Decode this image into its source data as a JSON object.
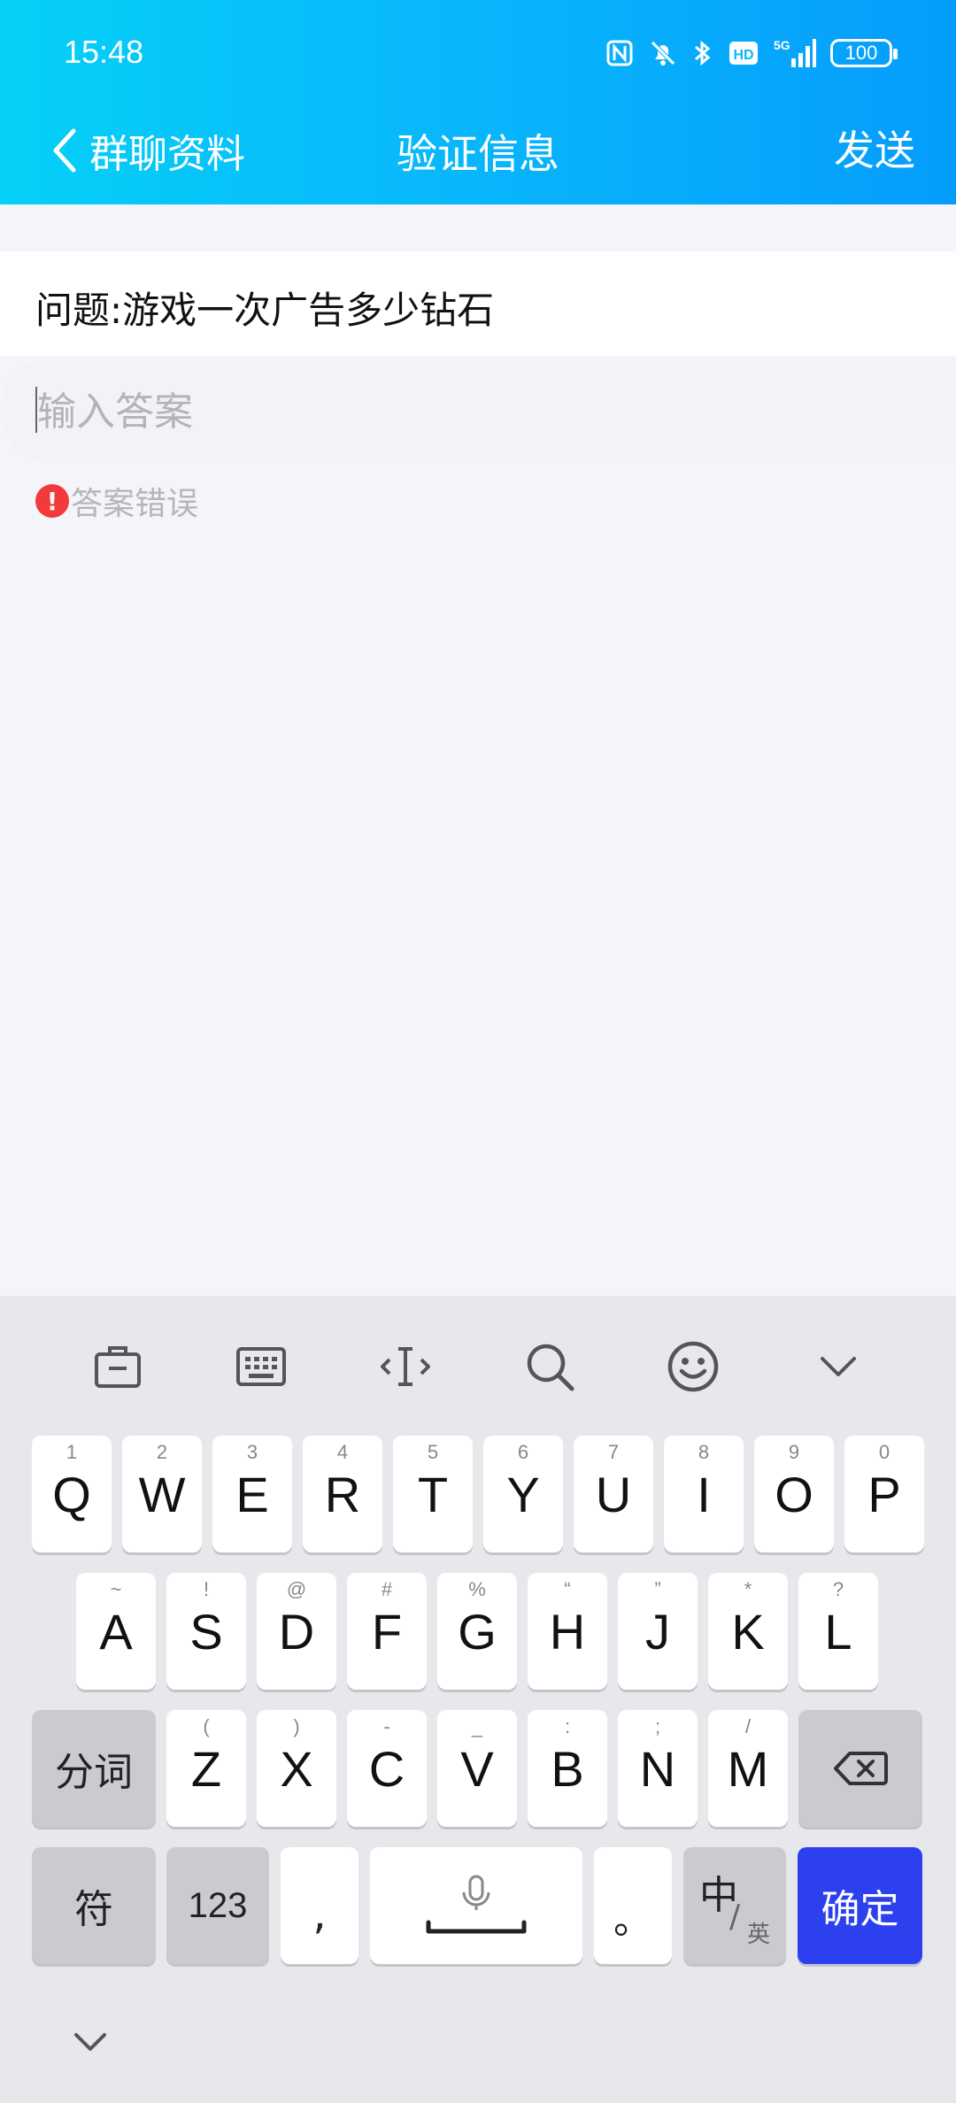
{
  "status": {
    "time": "15:48",
    "battery": "100"
  },
  "nav": {
    "back_label": "群聊资料",
    "title": "验证信息",
    "send_label": "发送"
  },
  "form": {
    "question": "问题:游戏一次广告多少钻石",
    "answer_placeholder": "输入答案",
    "answer_value": "",
    "error_text": "答案错误"
  },
  "keyboard": {
    "toolbar": [
      "toolbox-icon",
      "keyboard-icon",
      "cursor-icon",
      "search-icon",
      "emoji-icon",
      "collapse-icon"
    ],
    "row1": [
      {
        "k": "Q",
        "s": "1"
      },
      {
        "k": "W",
        "s": "2"
      },
      {
        "k": "E",
        "s": "3"
      },
      {
        "k": "R",
        "s": "4"
      },
      {
        "k": "T",
        "s": "5"
      },
      {
        "k": "Y",
        "s": "6"
      },
      {
        "k": "U",
        "s": "7"
      },
      {
        "k": "I",
        "s": "8"
      },
      {
        "k": "O",
        "s": "9"
      },
      {
        "k": "P",
        "s": "0"
      }
    ],
    "row2": [
      {
        "k": "A",
        "s": "~"
      },
      {
        "k": "S",
        "s": "!"
      },
      {
        "k": "D",
        "s": "@"
      },
      {
        "k": "F",
        "s": "#"
      },
      {
        "k": "G",
        "s": "%"
      },
      {
        "k": "H",
        "s": "“"
      },
      {
        "k": "J",
        "s": "”"
      },
      {
        "k": "K",
        "s": "*"
      },
      {
        "k": "L",
        "s": "?"
      }
    ],
    "row3": [
      {
        "k": "Z",
        "s": "("
      },
      {
        "k": "X",
        "s": ")"
      },
      {
        "k": "C",
        "s": "-"
      },
      {
        "k": "V",
        "s": "_"
      },
      {
        "k": "B",
        "s": ":"
      },
      {
        "k": "N",
        "s": ";"
      },
      {
        "k": "M",
        "s": "/"
      }
    ],
    "segment_label": "分词",
    "symbol_label": "符",
    "numbers_label": "123",
    "comma_label": ",",
    "period_label": "。",
    "lang_main": "中",
    "lang_sub": "英",
    "confirm_label": "确定"
  },
  "colors": {
    "accent": "#059dfc",
    "confirm": "#2c40f0",
    "error": "#f23a3a"
  }
}
